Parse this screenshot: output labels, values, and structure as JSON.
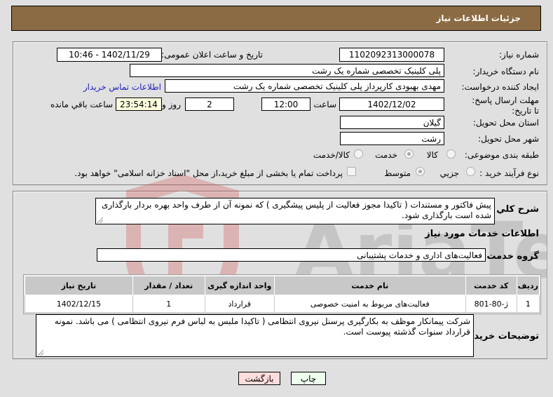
{
  "header": {
    "title": "جزئیات اطلاعات نیاز"
  },
  "form": {
    "need_number": {
      "label": "شماره نیاز:",
      "value": "1102092313000078"
    },
    "announce_datetime": {
      "label": "تاریخ و ساعت اعلان عمومی:",
      "value": "1402/11/29 - 10:46"
    },
    "buyer_org": {
      "label": "نام دستگاه خریدار:",
      "value": "پلی کلینیک تخصصی شماره یک رشت"
    },
    "requester": {
      "label": "ایجاد کننده درخواست:",
      "value": "مهدی بهبودی کارپرداز پلی کلینیک تخصصی شماره یک رشت",
      "contact_link": "اطلاعات تماس خریدار"
    },
    "deadline": {
      "label": "مهلت ارسال پاسخ: تا تاریخ:",
      "date": "1402/12/02",
      "time_label": "ساعت",
      "time": "12:00",
      "days": "2",
      "days_label": "روز و",
      "remaining": "23:54:14",
      "remaining_label": "ساعت باقي مانده"
    },
    "province": {
      "label": "استان محل تحویل:",
      "value": "گیلان"
    },
    "city": {
      "label": "شهر محل تحویل:",
      "value": "رشت"
    },
    "category": {
      "label": "طبقه بندی موضوعی:",
      "options": [
        "کالا",
        "خدمت",
        "کالا/خدمت"
      ],
      "selected": "خدمت"
    },
    "process": {
      "label": "نوع فرآیند خرید :",
      "options": [
        "جزیي",
        "متوسط"
      ],
      "selected": "متوسط",
      "treasury_checkbox": "پرداخت تمام یا بخشی از مبلغ خرید،از محل \"اسناد خزانه اسلامی\" خواهد بود.",
      "treasury_checked": false
    }
  },
  "description": {
    "label": "شرح كلي نياز:",
    "text": "پیش فاکتور و مستندات ( تاکیدا مجوز فعالیت از پلیس پیشگیری ) که نمونه آن از طرف واحد بهره بردار بارگذاری شده است بارگذاری شود."
  },
  "services": {
    "section_title": "اطلاعات خدمات مورد نیاز",
    "group_label": "گروه خدمت:",
    "group_value": "فعالیت‌های اداری و خدمات پشتیبانی",
    "columns": [
      "ردیف",
      "کد خدمت",
      "نام خدمت",
      "واحد اندازه گیری",
      "تعداد / مقدار",
      "تاریخ نیاز"
    ],
    "rows": [
      [
        "1",
        "ژ-80-801",
        "فعالیت‌های مربوط به امنیت خصوصی",
        "قرارداد",
        "1",
        "1402/12/15"
      ]
    ]
  },
  "buyer_notes": {
    "label": "توضیحات خریدار:",
    "text": "شرکت پیمانکار موظف به بکارگیری پرسنل نیروی انتظامی ( تاکیدا ملبس به لباس فرم نیروی انتظامی ) می باشد. نمونه قرارداد سنوات گذشته پیوست است."
  },
  "buttons": {
    "print": "چاپ",
    "back": "بازگشت"
  },
  "watermark": {
    "text": "AriaTender.neT"
  },
  "colors": {
    "header_bg": "#8b6b43",
    "print_bg": "#eeffee",
    "back_bg": "#ffdddd",
    "link": "#2020c0"
  }
}
